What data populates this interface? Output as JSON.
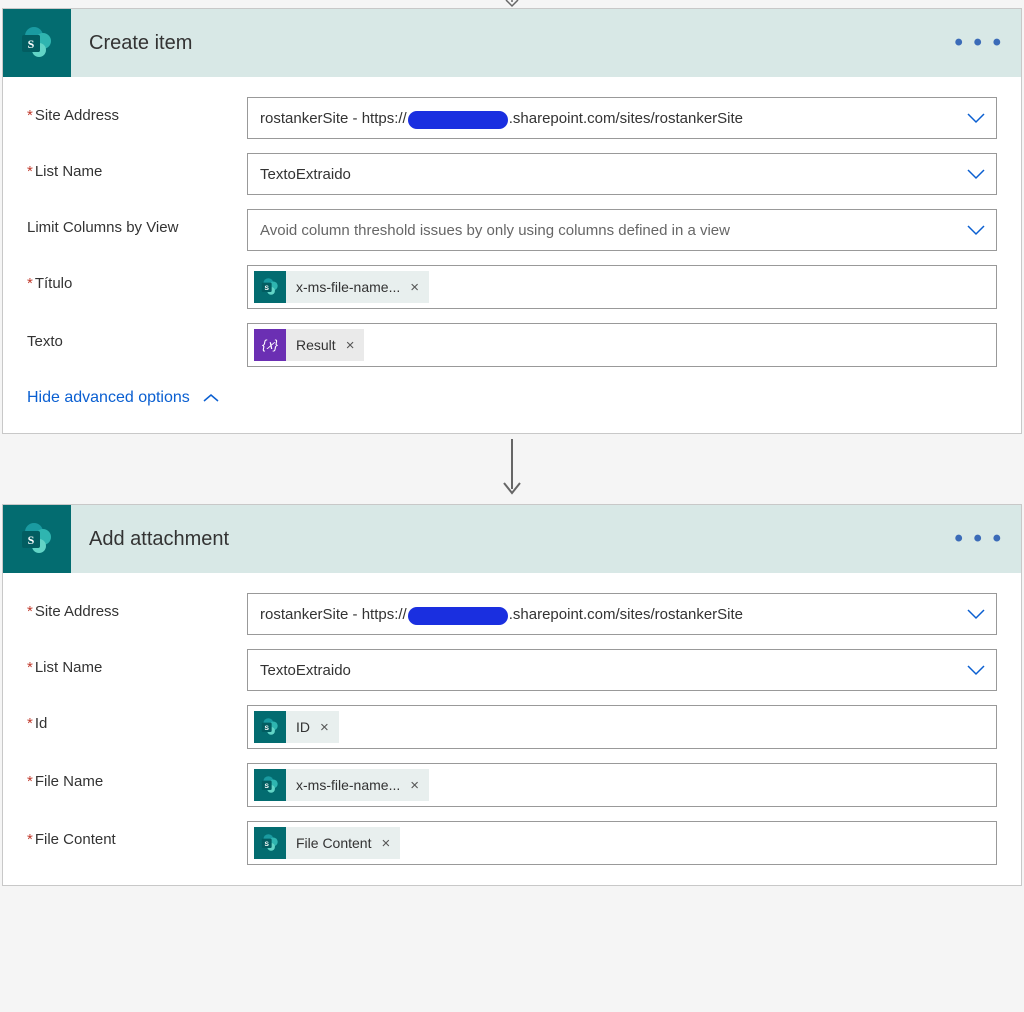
{
  "actions": {
    "createItem": {
      "title": "Create item",
      "fields": {
        "siteAddress": {
          "label": "Site Address",
          "prefix": "rostankerSite - https://",
          "suffix": ".sharepoint.com/sites/rostankerSite"
        },
        "listName": {
          "label": "List Name",
          "value": "TextoExtraido"
        },
        "limitColumns": {
          "label": "Limit Columns by View",
          "placeholder": "Avoid column threshold issues by only using columns defined in a view"
        },
        "titulo": {
          "label": "Título",
          "token": "x-ms-file-name..."
        },
        "texto": {
          "label": "Texto",
          "token": "Result",
          "fx": "{𝑥}"
        }
      },
      "advancedToggle": "Hide advanced options"
    },
    "addAttachment": {
      "title": "Add attachment",
      "fields": {
        "siteAddress": {
          "label": "Site Address",
          "prefix": "rostankerSite - https://",
          "suffix": ".sharepoint.com/sites/rostankerSite"
        },
        "listName": {
          "label": "List Name",
          "value": "TextoExtraido"
        },
        "id": {
          "label": "Id",
          "token": "ID"
        },
        "fileName": {
          "label": "File Name",
          "token": "x-ms-file-name..."
        },
        "fileContent": {
          "label": "File Content",
          "token": "File Content"
        }
      }
    }
  },
  "glyphs": {
    "menu": "• • •",
    "remove": "×"
  }
}
